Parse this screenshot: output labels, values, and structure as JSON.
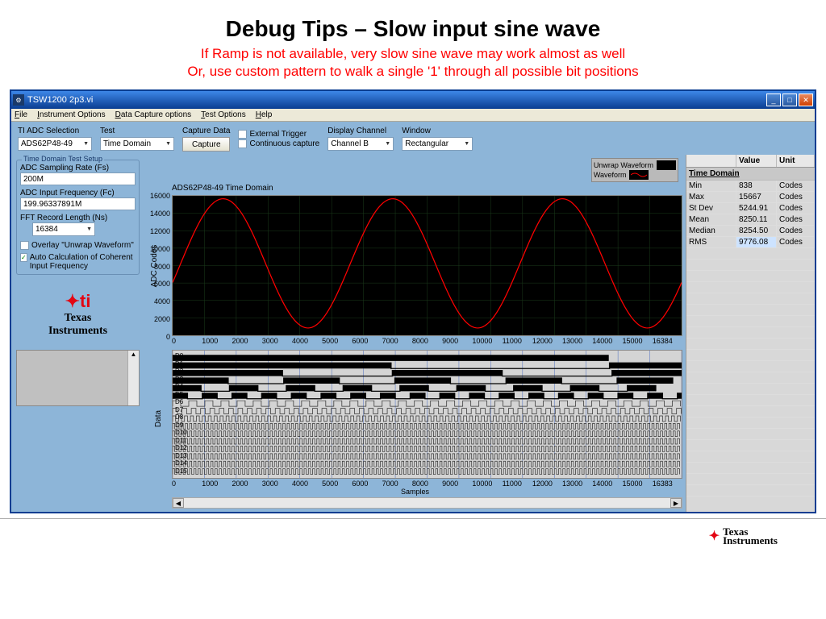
{
  "slide": {
    "title": "Debug Tips – Slow input sine wave",
    "sub1": "If Ramp is not available, very slow sine wave may work almost as well",
    "sub2": "Or, use custom pattern to walk a single '1' through all possible bit positions"
  },
  "window": {
    "title": "TSW1200 2p3.vi"
  },
  "menu": {
    "file": "File",
    "instrument": "Instrument Options",
    "datacapture": "Data Capture options",
    "test": "Test Options",
    "help": "Help"
  },
  "controls": {
    "adc_sel_label": "TI ADC Selection",
    "adc_sel_value": "ADS62P48-49",
    "test_label": "Test",
    "test_value": "Time Domain",
    "capture_label": "Capture Data",
    "capture_btn": "Capture",
    "ext_trigger": "External Trigger",
    "cont_capture": "Continuous capture",
    "disp_ch_label": "Display Channel",
    "disp_ch_value": "Channel B",
    "window_label": "Window",
    "window_value": "Rectangular"
  },
  "setup": {
    "title": "Time Domain Test Setup",
    "fs_label": "ADC Sampling Rate (Fs)",
    "fs_value": "200M",
    "fc_label": "ADC Input Frequency (Fc)",
    "fc_value": "199.96337891M",
    "ns_label": "FFT Record Length (Ns)",
    "ns_value": "16384",
    "overlay": "Overlay \"Unwrap Waveform\"",
    "autocalc": "Auto Calculation of Coherent Input Frequency"
  },
  "logo": {
    "brand": "Texas",
    "brand2": "Instruments"
  },
  "chart": {
    "title": "ADS62P48-49 Time Domain",
    "ylabel": "ADC Codes",
    "legend1": "Unwrap Waveform",
    "legend2": "Waveform",
    "data_ylabel": "Data",
    "data_xlabel": "Samples"
  },
  "stats": {
    "col_value": "Value",
    "col_unit": "Unit",
    "section": "Time Domain",
    "rows": [
      {
        "name": "Min",
        "value": "838",
        "unit": "Codes"
      },
      {
        "name": "Max",
        "value": "15667",
        "unit": "Codes"
      },
      {
        "name": "St Dev",
        "value": "5244.91",
        "unit": "Codes"
      },
      {
        "name": "Mean",
        "value": "8250.11",
        "unit": "Codes"
      },
      {
        "name": "Median",
        "value": "8254.50",
        "unit": "Codes"
      },
      {
        "name": "RMS",
        "value": "9776.08",
        "unit": "Codes"
      }
    ]
  },
  "chart_data": {
    "type": "line",
    "title": "ADS62P48-49 Time Domain",
    "xlabel": "Samples",
    "ylabel": "ADC Codes",
    "xlim": [
      0,
      16384
    ],
    "ylim": [
      0,
      16000
    ],
    "xticks": [
      0,
      1000,
      2000,
      3000,
      4000,
      5000,
      6000,
      7000,
      8000,
      9000,
      10000,
      11000,
      12000,
      13000,
      14000,
      15000,
      16384
    ],
    "yticks": [
      0,
      2000,
      4000,
      6000,
      8000,
      10000,
      12000,
      14000,
      16000
    ],
    "series": [
      {
        "name": "Waveform",
        "color": "#ff0000",
        "shape": "sine",
        "amplitude": 7414,
        "offset": 8252,
        "cycles": 3
      }
    ],
    "stats": {
      "min": 838,
      "max": 15667,
      "stdev": 5244.91,
      "mean": 8250.11,
      "median": 8254.5,
      "rms": 9776.08
    }
  },
  "digital": {
    "labels": [
      "D0",
      "D1",
      "D2",
      "D3",
      "D4",
      "D5",
      "D6",
      "D7",
      "D8",
      "D9",
      "D10",
      "D11",
      "D12",
      "D13",
      "D14",
      "D15"
    ],
    "xticks": [
      0,
      1000,
      2000,
      3000,
      4000,
      5000,
      6000,
      7000,
      8000,
      9000,
      10000,
      11000,
      12000,
      13000,
      14000,
      15000,
      16383
    ]
  }
}
